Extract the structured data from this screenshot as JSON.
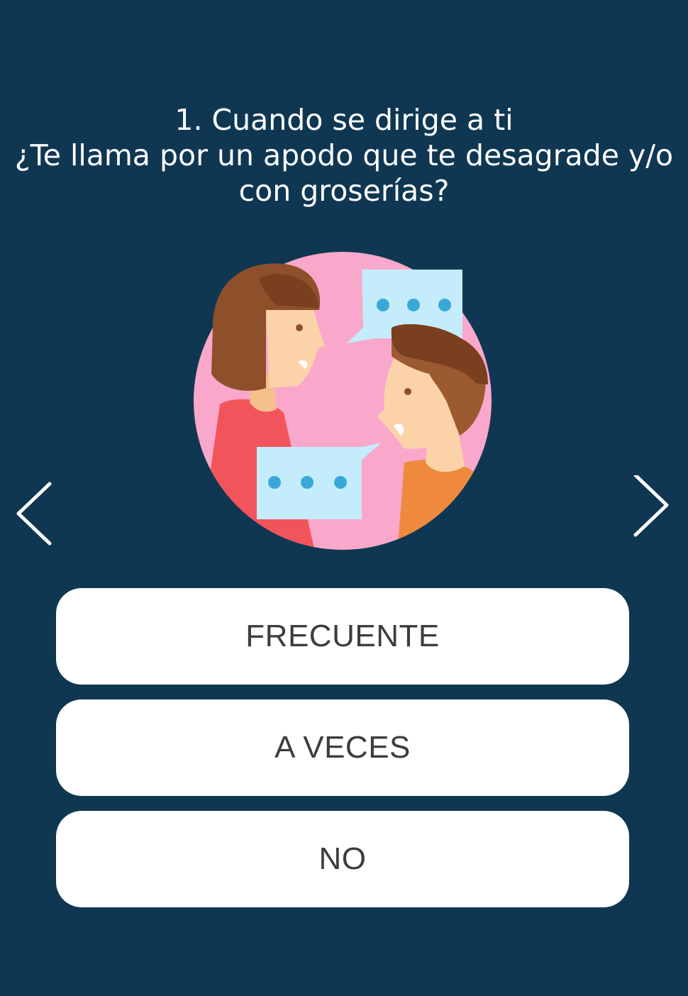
{
  "question": {
    "line1": "1. Cuando se dirige a ti",
    "line2": "¿Te llama por un apodo que te desagrade y/o",
    "line3": "con groserías?"
  },
  "illustration": {
    "icon": "two-people-talking-illustration",
    "colors": {
      "circle": "#f9a8cb",
      "bubble": "#c4ecfa",
      "dots": "#3ba7d9",
      "hair": "#8e4f2b",
      "skin": "#fcd3a8",
      "shirt_woman": "#f2545b",
      "shirt_man": "#ef8a3c"
    }
  },
  "navigation": {
    "prev_icon": "chevron-left-icon",
    "next_icon": "chevron-right-icon"
  },
  "answers": [
    {
      "label": "FRECUENTE"
    },
    {
      "label": "A VECES"
    },
    {
      "label": "NO"
    }
  ],
  "colors": {
    "background": "#0f3752",
    "button": "#ffffff",
    "button_text": "#3d3d3d",
    "question_text": "#ffffff"
  }
}
